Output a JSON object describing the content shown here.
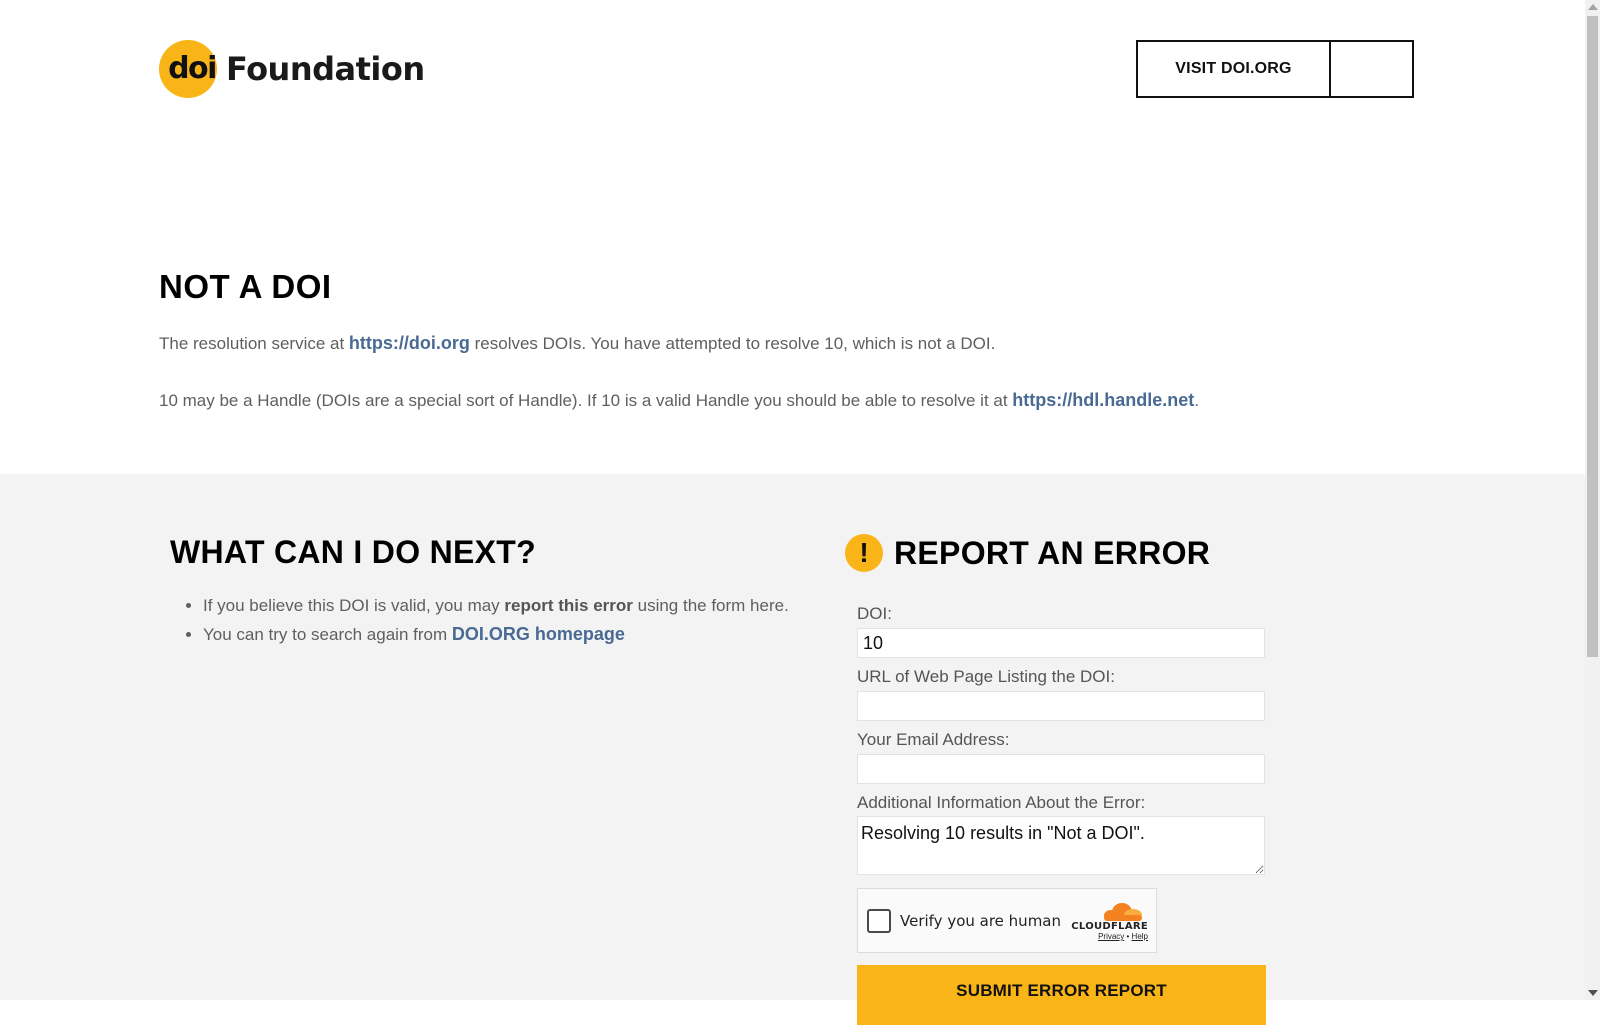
{
  "header": {
    "logo_mark": "doi",
    "logo_word": "Foundation",
    "visit_button": "VISIT DOI.ORG"
  },
  "main": {
    "title": "NOT A DOI",
    "p1_pre": "The resolution service at ",
    "p1_link": "https://doi.org",
    "p1_post": " resolves DOIs. You have attempted to resolve 10, which is not a DOI.",
    "p2_pre": "10 may be a Handle (DOIs are a special sort of Handle). If 10 is a valid Handle you should be able to resolve it at ",
    "p2_link": "https://hdl.handle.net",
    "p2_post": "."
  },
  "next_steps": {
    "title": "WHAT CAN I DO NEXT?",
    "item1_pre": "If you believe this DOI is valid, you may ",
    "item1_bold": "report this error",
    "item1_post": " using the form here.",
    "item2_pre": "You can try to search again from ",
    "item2_link": "DOI.ORG homepage"
  },
  "report": {
    "icon": "!",
    "title": "REPORT AN ERROR",
    "doi_label": "DOI:",
    "doi_value": "10",
    "url_label": "URL of Web Page Listing the DOI:",
    "url_value": "",
    "email_label": "Your Email Address:",
    "email_value": "",
    "info_label": "Additional Information About the Error:",
    "info_value": "Resolving 10 results in \"Not a DOI\".",
    "captcha_label": "Verify you are human",
    "captcha_brand": "CLOUDFLARE",
    "captcha_privacy": "Privacy",
    "captcha_sep": " • ",
    "captcha_help": "Help",
    "submit_label": "SUBMIT ERROR REPORT"
  },
  "colors": {
    "accent": "#f9b517",
    "link": "#4a6a94",
    "grey_bg": "#f3f3f3"
  }
}
